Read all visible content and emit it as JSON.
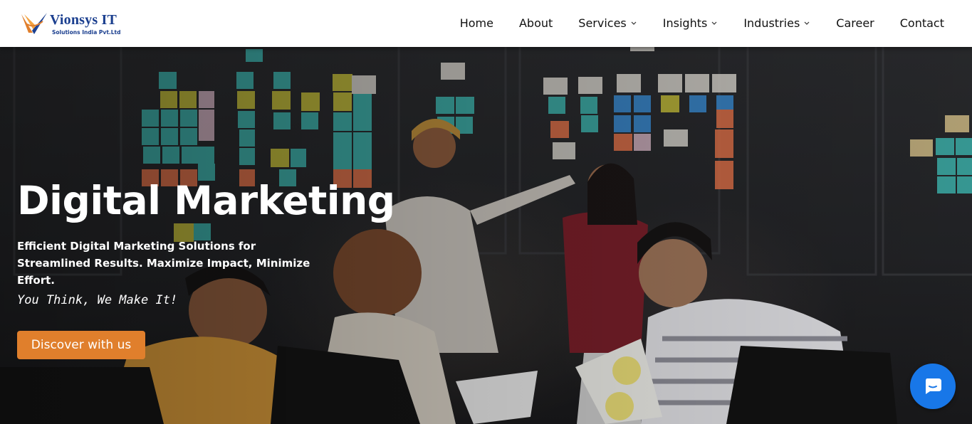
{
  "brand": {
    "name": "Vionsys IT",
    "tagline": "Solutions India Pvt.Ltd",
    "colors": {
      "primary": "#1b3f8f",
      "accent": "#e07f2c",
      "chat": "#1877e8"
    }
  },
  "nav": {
    "items": [
      {
        "label": "Home",
        "dropdown": false
      },
      {
        "label": "About",
        "dropdown": false
      },
      {
        "label": "Services",
        "dropdown": true
      },
      {
        "label": "Insights",
        "dropdown": true
      },
      {
        "label": "Industries",
        "dropdown": true
      },
      {
        "label": "Career",
        "dropdown": false
      },
      {
        "label": "Contact",
        "dropdown": false
      }
    ]
  },
  "hero": {
    "title": "Digital Marketing",
    "subtitle": "Efficient Digital Marketing Solutions for Streamlined Results. Maximize Impact, Minimize Effort.",
    "tagline": "You Think, We Make It!",
    "cta_label": "Discover with us"
  },
  "icons": {
    "caret": "chevron-down-icon",
    "chat": "chat-bubble-icon"
  }
}
